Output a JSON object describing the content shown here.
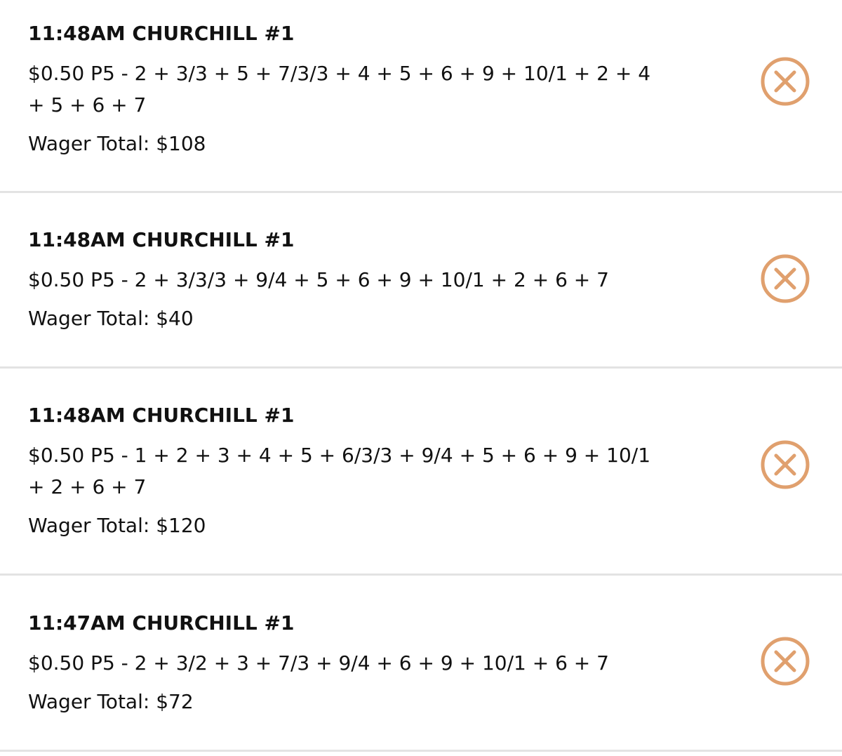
{
  "accent_color": "#E0A06E",
  "wagers": [
    {
      "title": "11:48AM CHURCHILL #1",
      "detail": "$0.50 P5 - 2 + 3/3 + 5 + 7/3/3 + 4 + 5 + 6 + 9 + 10/1 + 2 + 4 + 5 + 6 + 7",
      "total": "Wager Total: $108",
      "cancel_icon": "circle-x-icon"
    },
    {
      "title": "11:48AM CHURCHILL #1",
      "detail": "$0.50 P5 - 2 + 3/3/3 + 9/4 + 5 + 6 + 9 + 10/1 + 2 + 6 + 7",
      "total": "Wager Total: $40",
      "cancel_icon": "circle-x-icon"
    },
    {
      "title": "11:48AM CHURCHILL #1",
      "detail": "$0.50 P5 - 1 + 2 + 3 + 4 + 5 + 6/3/3 + 9/4 + 5 + 6 + 9 + 10/1 + 2 + 6 + 7",
      "total": "Wager Total: $120",
      "cancel_icon": "circle-x-icon"
    },
    {
      "title": "11:47AM CHURCHILL #1",
      "detail": "$0.50 P5 - 2 + 3/2 + 3 + 7/3 + 9/4 + 6 + 9 + 10/1 + 6 + 7",
      "total": "Wager Total: $72",
      "cancel_icon": "circle-x-icon"
    }
  ]
}
